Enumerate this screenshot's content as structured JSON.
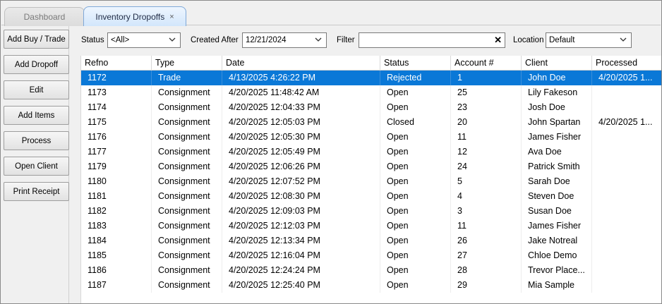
{
  "tabs": [
    {
      "label": "Dashboard"
    },
    {
      "label": "Inventory Dropoffs",
      "close": "×"
    }
  ],
  "sidebar": {
    "buttons": [
      {
        "label": "Add Buy / Trade"
      },
      {
        "label": "Add Dropoff"
      },
      {
        "label": "Edit"
      },
      {
        "label": "Add Items"
      },
      {
        "label": "Process"
      },
      {
        "label": "Open Client"
      },
      {
        "label": "Print Receipt"
      }
    ]
  },
  "filters": {
    "status_label": "Status",
    "status_value": "<All>",
    "created_after_label": "Created After",
    "created_after_value": "12/21/2024",
    "filter_label": "Filter",
    "filter_value": "",
    "location_label": "Location",
    "location_value": "Default"
  },
  "grid": {
    "columns": [
      "Refno",
      "Type",
      "Date",
      "Status",
      "Account #",
      "Client",
      "Processed"
    ],
    "selected_row": 0,
    "rows": [
      [
        "1172",
        "Trade",
        "4/13/2025 4:26:22 PM",
        "Rejected",
        "1",
        "John Doe",
        "4/20/2025 1..."
      ],
      [
        "1173",
        "Consignment",
        "4/20/2025 11:48:42 AM",
        "Open",
        "25",
        "Lily Fakeson",
        ""
      ],
      [
        "1174",
        "Consignment",
        "4/20/2025 12:04:33 PM",
        "Open",
        "23",
        "Josh Doe",
        ""
      ],
      [
        "1175",
        "Consignment",
        "4/20/2025 12:05:03 PM",
        "Closed",
        "20",
        "John Spartan",
        "4/20/2025 1..."
      ],
      [
        "1176",
        "Consignment",
        "4/20/2025 12:05:30 PM",
        "Open",
        "11",
        "James Fisher",
        ""
      ],
      [
        "1177",
        "Consignment",
        "4/20/2025 12:05:49 PM",
        "Open",
        "12",
        "Ava Doe",
        ""
      ],
      [
        "1179",
        "Consignment",
        "4/20/2025 12:06:26 PM",
        "Open",
        "24",
        "Patrick Smith",
        ""
      ],
      [
        "1180",
        "Consignment",
        "4/20/2025 12:07:52 PM",
        "Open",
        "5",
        "Sarah Doe",
        ""
      ],
      [
        "1181",
        "Consignment",
        "4/20/2025 12:08:30 PM",
        "Open",
        "4",
        "Steven Doe",
        ""
      ],
      [
        "1182",
        "Consignment",
        "4/20/2025 12:09:03 PM",
        "Open",
        "3",
        "Susan Doe",
        ""
      ],
      [
        "1183",
        "Consignment",
        "4/20/2025 12:12:03 PM",
        "Open",
        "11",
        "James Fisher",
        ""
      ],
      [
        "1184",
        "Consignment",
        "4/20/2025 12:13:34 PM",
        "Open",
        "26",
        "Jake Notreal",
        ""
      ],
      [
        "1185",
        "Consignment",
        "4/20/2025 12:16:04 PM",
        "Open",
        "27",
        "Chloe Demo",
        ""
      ],
      [
        "1186",
        "Consignment",
        "4/20/2025 12:24:24 PM",
        "Open",
        "28",
        "Trevor Place...",
        ""
      ],
      [
        "1187",
        "Consignment",
        "4/20/2025 12:25:40 PM",
        "Open",
        "29",
        "Mia Sample",
        ""
      ]
    ]
  },
  "colors": {
    "selection": "#0a78d7",
    "active_tab": "#d2e6fb"
  }
}
